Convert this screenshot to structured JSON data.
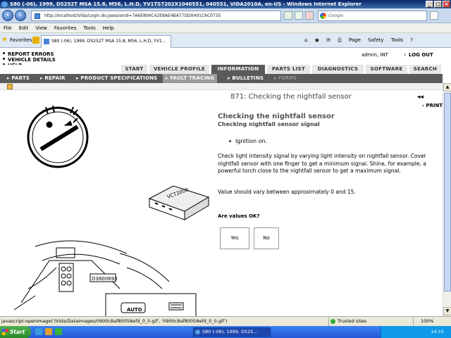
{
  "window": {
    "title": "S80 (-06), 1999, D5252T MSA 15.8, M56, L.H.D, YV1TS7202X1040551, 040551, VIDA2010A, en-US - Windows Internet Explorer"
  },
  "browser": {
    "address": "http://localhost/Vida/Login.do;jsessionid=7A6E806C42E8AE4BA77DD0491C6C0735",
    "search_placeholder": "Google",
    "menu": [
      "File",
      "Edit",
      "View",
      "Favorites",
      "Tools",
      "Help"
    ],
    "favorites_label": "Favorites",
    "tab_title": "S80 (-06), 1999, D5252T MSA 15.8, M56, L.H.D, YV1...",
    "commands": [
      "Page",
      "Safety",
      "Tools"
    ]
  },
  "app": {
    "top_links": [
      "REPORT ERRORS",
      "VEHICLE DETAILS",
      "HELP"
    ],
    "user": "admin, INT",
    "logout": "LOG OUT",
    "main_tabs": [
      "START",
      "VEHICLE PROFILE",
      "INFORMATION",
      "PARTS LIST",
      "DIAGNOSTICS",
      "SOFTWARE",
      "SEARCH"
    ],
    "active_tab": "INFORMATION",
    "sub_nav": [
      "PARTS",
      "REPAIR",
      "PRODUCT SPECIFICATIONS",
      "FAULT TRACING",
      "BULLETINS",
      "FORMS"
    ],
    "active_sub": "FAULT TRACING"
  },
  "content": {
    "page_header": "871: Checking the nightfall sensor",
    "print_label": "PRINT",
    "heading": "Checking the nightfall sensor",
    "subheading": "Checking nightfall sensor signal",
    "step": "Ignition on.",
    "instruction": "Check light intensity signal by varying light intensity on nightfall sensor. Cover nightfall sensor with one finger to get a minimum signal. Shine, for example, a powerful torch close to the nightfall sensor to get a maximum signal.",
    "expected": "Value should vary between approximately 0 and 15.",
    "question": "Are values OK?",
    "yes_label": "Yes",
    "no_label": "No",
    "figure_label": "D3800693",
    "vct_label": "VCT2000",
    "auto_label": "AUTO"
  },
  "status": {
    "text": "javascript:openImage('/Vida/DataImages/0900c8af80058efd_0_0.gif', '0900c8af80058efd_0_0.gif')",
    "zone": "Trusted sites",
    "zoom": "100%"
  },
  "taskbar": {
    "start": "Start",
    "task": "S80 (-06), 1999, D525...",
    "clock": "14:15"
  }
}
